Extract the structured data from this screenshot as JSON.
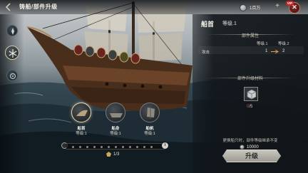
{
  "header": {
    "title": "铸船/部件升级",
    "currency_value": "1百万",
    "vip_badge": "VIP"
  },
  "icons": {
    "nav": [
      "compass-icon",
      "snowflake-icon",
      "gear-wheel-icon"
    ],
    "close": "close-icon",
    "plus": "plus-icon"
  },
  "parts": [
    {
      "name": "船首",
      "level_text": "等级:1",
      "selected": true
    },
    {
      "name": "船身",
      "level_text": "等级:1",
      "selected": false
    },
    {
      "name": "船帆",
      "level_text": "等级:1",
      "selected": false
    }
  ],
  "progress": {
    "stage_text": "1/3",
    "info_label": "i"
  },
  "panel": {
    "part_name": "船首",
    "part_level": "等级.1",
    "attributes_title": "部件属性",
    "level_col_1": "等级.1",
    "level_col_2": "等级.2",
    "attribute_name": "攻击",
    "attribute_from": "1",
    "attribute_to": "2",
    "materials_title": "部件升级材料",
    "material_have": "0",
    "material_need": "/5",
    "hint": "更换船只时，部件等级继承不变",
    "cost": "10000",
    "upgrade_label": "升级"
  },
  "colors": {
    "accent_gold": "#e8d9b0",
    "shortage_red": "#e04848",
    "button_silver": "#c9c6bd"
  }
}
